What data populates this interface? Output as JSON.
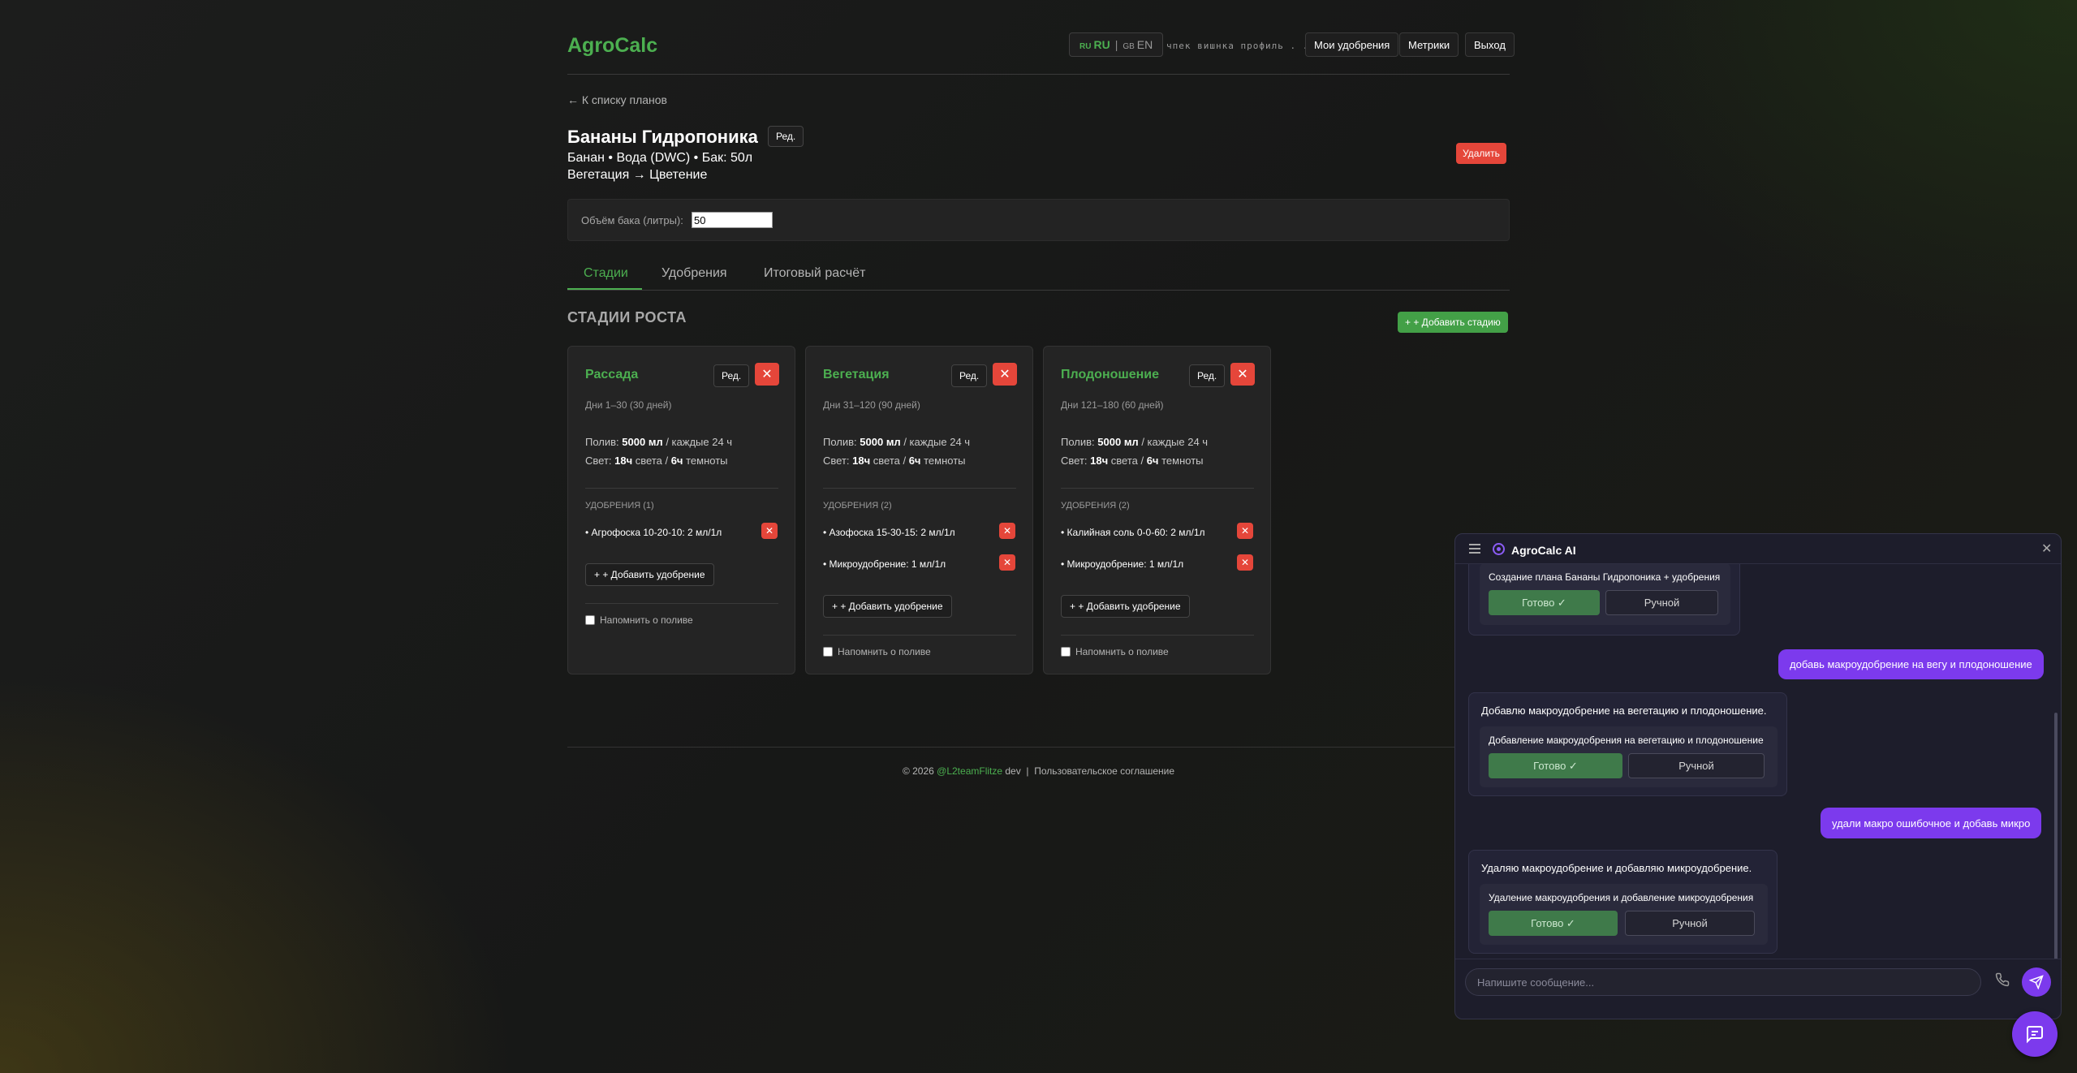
{
  "header": {
    "logo": "AgroCalc",
    "lang_ru_flag": "RU",
    "lang_ru_label": "RU",
    "lang_sep": "|",
    "lang_en_flag": "GB",
    "lang_en_label": "EN",
    "user_name": "чпек вишнка профиль . . .",
    "nav_fertilizers": "Мои удобрения",
    "nav_metrics": "Метрики",
    "nav_logout": "Выход"
  },
  "plan": {
    "back_link": "← К списку планов",
    "title": "Бананы Гидропоника",
    "edit_label": "Ред.",
    "subtitle_1": "Банан • Вода (DWC) • Бак: 50л",
    "subtitle_2": "Вегетация → Цветение",
    "delete_label": "Удалить",
    "volume_label": "Объём бака (литры):",
    "volume_value": "50"
  },
  "tabs": [
    "Стадии",
    "Удобрения",
    "Итоговый расчёт"
  ],
  "section": {
    "title": "СТАДИИ РОСТА",
    "add_stage": "+ + Добавить стадию"
  },
  "stage_labels": {
    "edit": "Ред.",
    "delete": "✕",
    "watering_prefix": "Полив:",
    "light_prefix": "Свет:",
    "add_fertilizer": "+ + Добавить удобрение",
    "remind": "Напомнить о поливе",
    "fert_delete": "✕"
  },
  "stages": [
    {
      "name": "Рассада",
      "days": "Дни 1–30 (30 дней)",
      "water_amount": "5000 мл",
      "water_interval": " / каждые 24 ч",
      "light_on": "18ч",
      "light_mid": " света / ",
      "light_off": "6ч",
      "light_end": " темноты",
      "fert_head": "УДОБРЕНИЯ (1)",
      "fertilizers": [
        "• Агрофоска 10-20-10: 2 мл/1л"
      ]
    },
    {
      "name": "Вегетация",
      "days": "Дни 31–120 (90 дней)",
      "water_amount": "5000 мл",
      "water_interval": " / каждые 24 ч",
      "light_on": "18ч",
      "light_mid": " света / ",
      "light_off": "6ч",
      "light_end": " темноты",
      "fert_head": "УДОБРЕНИЯ (2)",
      "fertilizers": [
        "• Азофоска 15-30-15: 2 мл/1л",
        "• Микроудобрение: 1 мл/1л"
      ]
    },
    {
      "name": "Плодоношение",
      "days": "Дни 121–180 (60 дней)",
      "water_amount": "5000 мл",
      "water_interval": " / каждые 24 ч",
      "light_on": "18ч",
      "light_mid": " света / ",
      "light_off": "6ч",
      "light_end": " темноты",
      "fert_head": "УДОБРЕНИЯ (2)",
      "fertilizers": [
        "• Калийная соль 0-0-60: 2 мл/1л",
        "• Микроудобрение: 1 мл/1л"
      ]
    }
  ],
  "footer": {
    "copyright": "© 2026 ",
    "brand": "@L2teamFlitze",
    "dev": " dev",
    "sep": "|",
    "agreement": "Пользовательское соглашение"
  },
  "chat": {
    "title": "AgroCalc AI",
    "done_label": "Готово ✓",
    "manual_label": "Ручной",
    "msg1_action": "Создание плана Бананы Гидропоника + удобрения",
    "msg2_user": "добавь макроудобрение на вегу и плодоношение",
    "msg3_text": "Добавлю макроудобрение на вегетацию и плодоношение.",
    "msg3_action": "Добавление макроудобрения на вегетацию и плодоношение",
    "msg4_user": "удали макро ошибочное и добавь микро",
    "msg5_text": "Удаляю макроудобрение и добавляю микроудобрение.",
    "msg5_action": "Удаление макроудобрения и добавление микроудобрения",
    "input_placeholder": "Напишите сообщение..."
  },
  "colors": {
    "accent_green": "#4caf50",
    "danger_red": "#e5463a",
    "chat_purple": "#7c3aed"
  }
}
